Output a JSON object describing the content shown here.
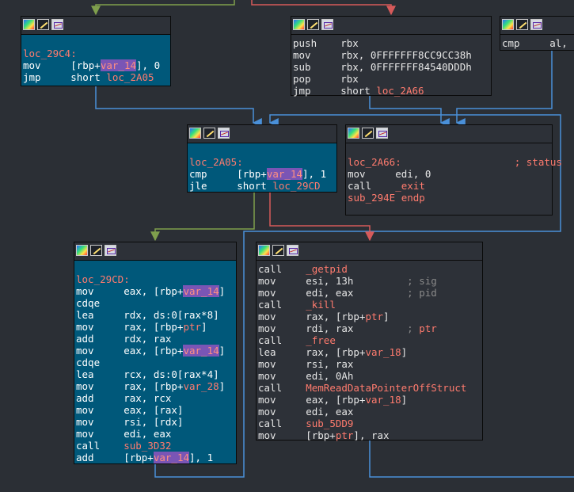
{
  "colors": {
    "background": "#2b2f35",
    "node_fill": "#2d3138",
    "node_selected_fill": "#00587a",
    "label": "#ff7b6e",
    "highlight": "#7a55b5",
    "edge_blue": "#4a90d9",
    "edge_red": "#d65a5a",
    "edge_green": "#7f9f4d"
  },
  "icons": [
    "graph-overview-icon",
    "rename-icon",
    "xref-icon"
  ],
  "nodes": {
    "n29c4": {
      "lines": [
        "loc_29C4:",
        "mov     [rbp+var_14], 0",
        "jmp     short loc_2A05"
      ]
    },
    "npush": {
      "lines": [
        "push    rbx",
        "mov     rbx, 0FFFFFFF8CC9CC38h",
        "sub     rbx, 0FFFFFFF84540DDDh",
        "pop     rbx",
        "jmp     short loc_2A66"
      ]
    },
    "ncmp": {
      "lines": [
        "cmp     al, "
      ]
    },
    "n2a05": {
      "lines": [
        "loc_2A05:",
        "cmp     [rbp+var_14], 1",
        "jle     short loc_29CD"
      ]
    },
    "n2a66": {
      "lines": [
        "loc_2A66:                   ; status",
        "mov     edi, 0",
        "call    _exit",
        "sub_294E endp"
      ]
    },
    "n29cd": {
      "lines": [
        "loc_29CD:",
        "mov     eax, [rbp+var_14]",
        "cdqe",
        "lea     rdx, ds:0[rax*8]",
        "mov     rax, [rbp+ptr]",
        "add     rdx, rax",
        "mov     eax, [rbp+var_14]",
        "cdqe",
        "lea     rcx, ds:0[rax*4]",
        "mov     rax, [rbp+var_28]",
        "add     rax, rcx",
        "mov     eax, [rax]",
        "mov     rsi, [rdx]",
        "mov     edi, eax",
        "call    sub_3D32",
        "add     [rbp+var_14], 1"
      ]
    },
    "ncall": {
      "lines": [
        "call    _getpid",
        "mov     esi, 13h         ; sig",
        "mov     edi, eax         ; pid",
        "call    _kill",
        "mov     rax, [rbp+ptr]",
        "mov     rdi, rax         ; ptr",
        "call    _free",
        "lea     rax, [rbp+var_18]",
        "mov     rsi, rax",
        "mov     edi, 0Ah",
        "call    MemReadDataPointerOffStruct",
        "mov     eax, [rbp+var_18]",
        "mov     edi, eax",
        "call    sub_5DD9",
        "mov     [rbp+ptr], rax"
      ]
    }
  }
}
